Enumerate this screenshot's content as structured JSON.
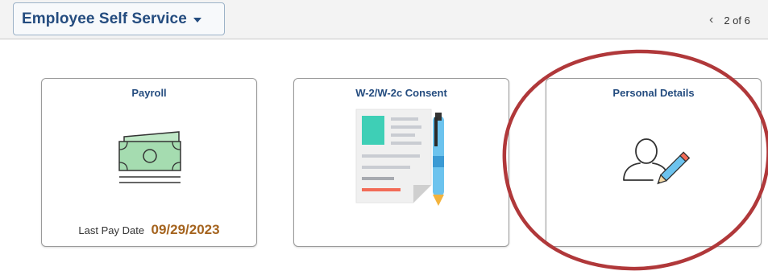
{
  "header": {
    "homepage_title": "Employee Self Service",
    "pager_text": "2 of 6",
    "pager_prev_symbol": "‹"
  },
  "tiles": [
    {
      "title": "Payroll",
      "icon": "money-icon",
      "footer_label": "Last Pay Date",
      "footer_value": "09/29/2023"
    },
    {
      "title": "W-2/W-2c Consent",
      "icon": "document-pen-icon"
    },
    {
      "title": "Personal Details",
      "icon": "person-edit-icon"
    }
  ],
  "colors": {
    "brand": "#244c7f",
    "date_accent": "#a5641f",
    "annotation": "#b0383a",
    "money_green": "#a5dcb0",
    "doc_teal": "#3ecfb6",
    "pen_blue": "#6cc3ee",
    "doc_red": "#f26b57"
  }
}
